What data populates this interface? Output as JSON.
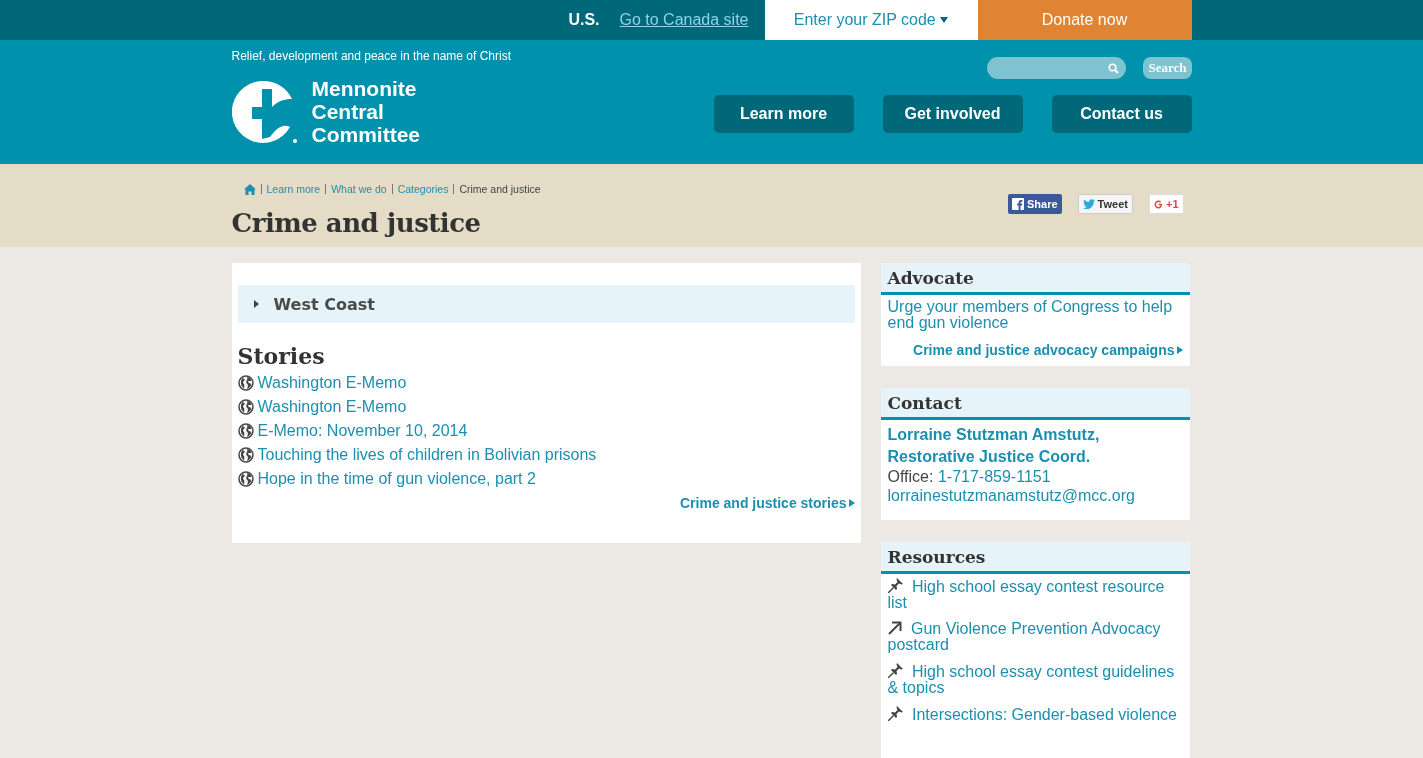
{
  "top_bar": {
    "country": "U.S.",
    "canada_link": "Go to Canada site",
    "zip_dropdown": "Enter your ZIP code",
    "donate": "Donate now"
  },
  "header": {
    "tagline": "Relief, development and peace in the name of Christ",
    "logo_text": [
      "Mennonite",
      "Central",
      "Committee"
    ],
    "search_button": "Search",
    "nav": [
      "Learn more",
      "Get involved",
      "Contact us"
    ]
  },
  "breadcrumb": [
    "Learn more",
    "What we do",
    "Categories",
    "Crime and justice"
  ],
  "share": [
    {
      "kind": "facebook",
      "label": "Share"
    },
    {
      "kind": "twitter",
      "label": "Tweet"
    },
    {
      "kind": "gplus",
      "label": "+1"
    }
  ],
  "page_title": "Crime and justice",
  "main": {
    "accordion": {
      "label": "West Coast",
      "expanded": false
    },
    "stories_heading": "Stories",
    "stories": [
      "Washington E-Memo",
      "Washington E-Memo",
      "E-Memo: November 10, 2014",
      "Touching the lives of children in Bolivian prisons",
      "Hope in the time of gun violence, part 2"
    ],
    "more_link": "Crime and justice stories"
  },
  "advocate": {
    "heading": "Advocate",
    "text": "Urge your members of Congress to help end gun violence",
    "link": "Crime and justice advocacy campaigns"
  },
  "contact": {
    "heading": "Contact",
    "name": "Lorraine Stutzman Amstutz,",
    "role": "Restorative Justice Coord.",
    "office_label": "Office:",
    "phone": "1-717-859-1151",
    "email": "lorrainestutzmanamstutz@mcc.org"
  },
  "resources": {
    "heading": "Resources",
    "items": [
      {
        "kind": "pin",
        "label": "High school essay contest resource list"
      },
      {
        "kind": "external",
        "label": "Gun Violence Prevention Advocacy postcard"
      },
      {
        "kind": "pin",
        "label": "High school essay contest guidelines & topics"
      },
      {
        "kind": "pin",
        "label": "Intersections: Gender-based violence"
      }
    ]
  }
}
